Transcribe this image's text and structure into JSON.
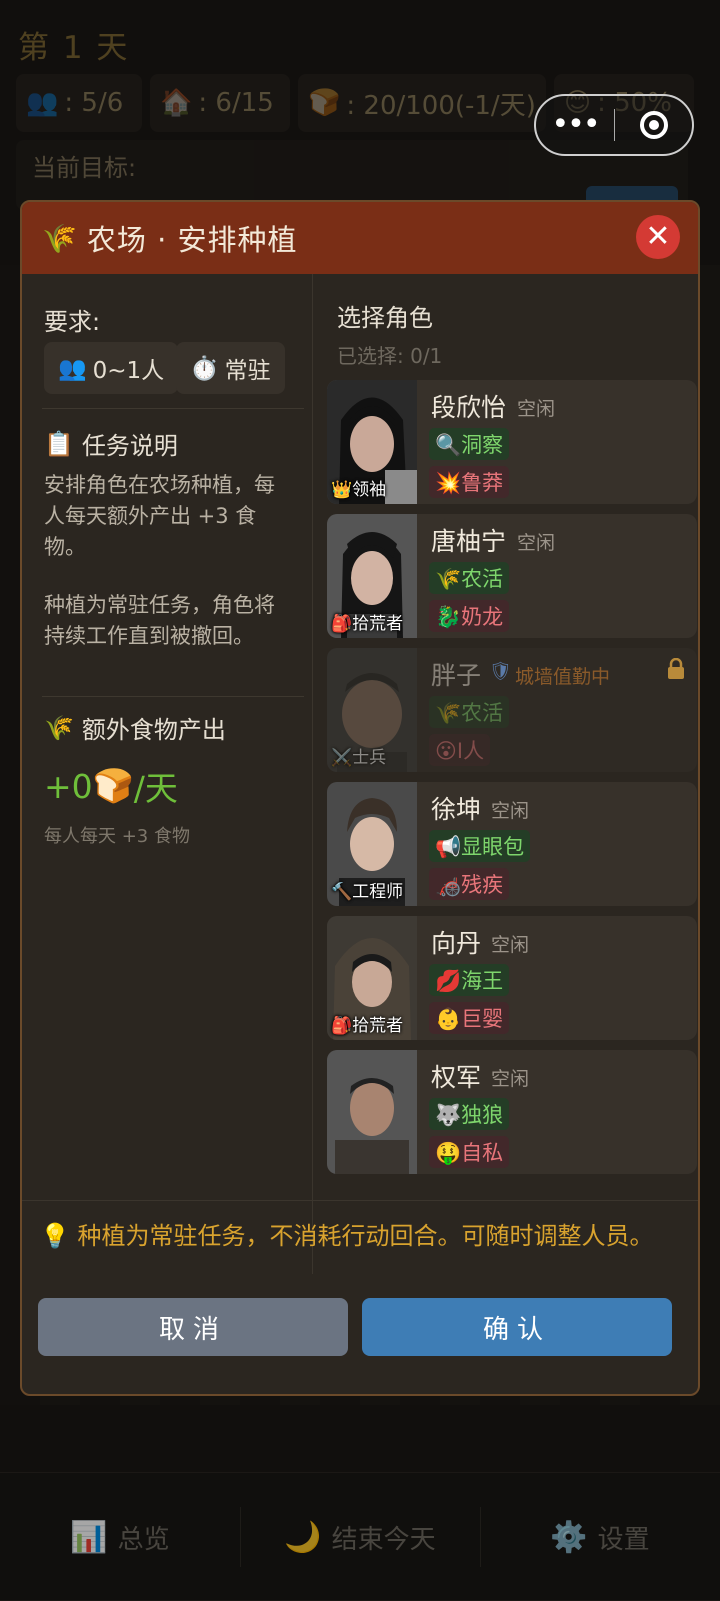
{
  "hud": {
    "day": "第 1 天",
    "population": {
      "icon": "👥",
      "value": ":  5/6"
    },
    "housing": {
      "icon": "🏠",
      "value": ":  6/15"
    },
    "food": {
      "icon": "🍞",
      "value": ":  20/100(-1/天)"
    },
    "morale": {
      "icon": "😊",
      "value": ":  50%"
    },
    "goal_label": "当前目标:"
  },
  "modal": {
    "header_icon": "🌾",
    "title": "农场 · 安排种植",
    "close_label": "✕",
    "requirements_label": "要求:",
    "req_people": {
      "icon": "👥",
      "text": "0~1人"
    },
    "req_duration": {
      "icon": "⏱️",
      "text": "常驻"
    },
    "task_desc_icon": "📋",
    "task_desc_title": "任务说明",
    "task_desc_1": "安排角色在农场种植，每人每天额外产出 +3 食物。",
    "task_desc_2": "种植为常驻任务，角色将持续工作直到被撤回。",
    "output_icon": "🌾",
    "output_title": "额外食物产出",
    "output_value": "+0",
    "output_unit_icon": "🍞",
    "output_unit": "/天",
    "output_note": "每人每天 +3 食物",
    "select_title": "选择角色",
    "selected_count": "已选择: 0/1",
    "characters": [
      {
        "name": "段欣怡",
        "status": "空闲",
        "role": "👑领袖",
        "tag1": "🔍洞察",
        "tag2": "💥鲁莽",
        "locked": false
      },
      {
        "name": "唐柚宁",
        "status": "空闲",
        "role": "🎒拾荒者",
        "tag1": "🌾农活",
        "tag2": "🐉奶龙",
        "locked": false
      },
      {
        "name": "胖子",
        "status": "城墙值勤中",
        "role": "⚔️士兵",
        "tag1": "🌾农活",
        "tag2": "😮I人",
        "locked": true
      },
      {
        "name": "徐坤",
        "status": "空闲",
        "role": "🔨工程师",
        "tag1": "📢显眼包",
        "tag2": "🦽残疾",
        "locked": false
      },
      {
        "name": "向丹",
        "status": "空闲",
        "role": "🎒拾荒者",
        "tag1": "💋海王",
        "tag2": "👶巨婴",
        "locked": false
      },
      {
        "name": "权军",
        "status": "空闲",
        "role": "",
        "tag1": "🐺独狼",
        "tag2": "🤑自私",
        "locked": false
      }
    ],
    "tip": "💡 种植为常驻任务，不消耗行动回合。可随时调整人员。",
    "cancel_label": "取消",
    "confirm_label": "确认"
  },
  "nav": {
    "overview": {
      "icon": "📊",
      "label": "总览"
    },
    "end_day": {
      "icon": "🌙",
      "label": "结束今天"
    },
    "settings": {
      "icon": "⚙️",
      "label": "设置"
    }
  },
  "colors": {
    "modal_header": "#7a2e16",
    "close": "#d43a34",
    "confirm": "#3e7db5",
    "cancel": "#6b7482",
    "good_tag": "#7ed66c",
    "bad_tag": "#e8757a",
    "food_output": "#6fbf3a",
    "tip": "#d9a32e"
  }
}
